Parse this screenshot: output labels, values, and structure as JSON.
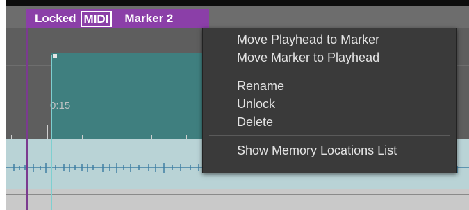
{
  "marker": {
    "locked_label": "Locked",
    "midi_label": "MIDI",
    "name": "Marker 2",
    "color": "#8b3fa8"
  },
  "timeline": {
    "time_label": "0:15",
    "clip_color": "#3f7f7f"
  },
  "context_menu": {
    "items": [
      {
        "label": "Move Playhead to Marker"
      },
      {
        "label": "Move Marker to Playhead"
      },
      {
        "label": "Rename"
      },
      {
        "label": "Unlock"
      },
      {
        "label": "Delete"
      },
      {
        "label": "Show Memory Locations List"
      }
    ]
  }
}
